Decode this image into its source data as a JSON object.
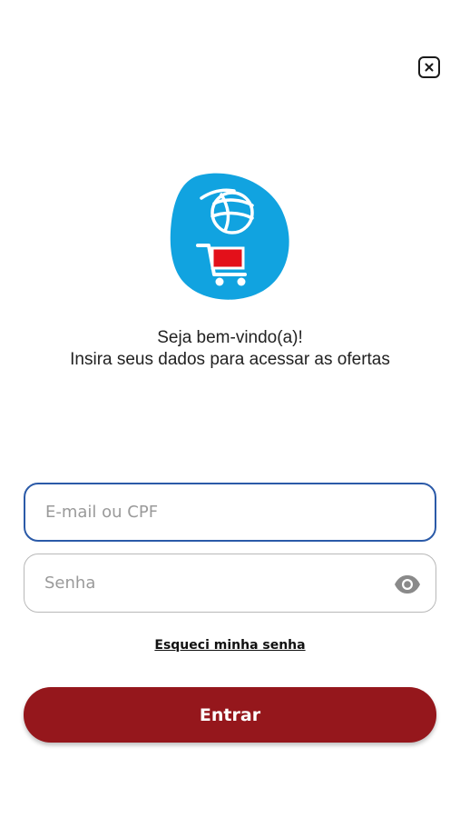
{
  "login": {
    "welcome_line1": "Seja bem-vindo(a)!",
    "welcome_line2": "Insira seus dados para acessar as ofertas",
    "email_placeholder": "E-mail ou CPF",
    "email_value": "",
    "password_placeholder": "Senha",
    "password_value": "",
    "forgot_password_label": "Esqueci minha senha",
    "submit_label": "Entrar"
  },
  "icons": {
    "close": "close-icon",
    "logo": "globe-cart-logo",
    "password_toggle": "eye-icon"
  },
  "colors": {
    "brand_blue": "#11a3e0",
    "cart_red": "#e3101a",
    "button_red": "#95171c",
    "field_focus_border": "#2b5aa8",
    "field_border": "#b8b8b8"
  }
}
